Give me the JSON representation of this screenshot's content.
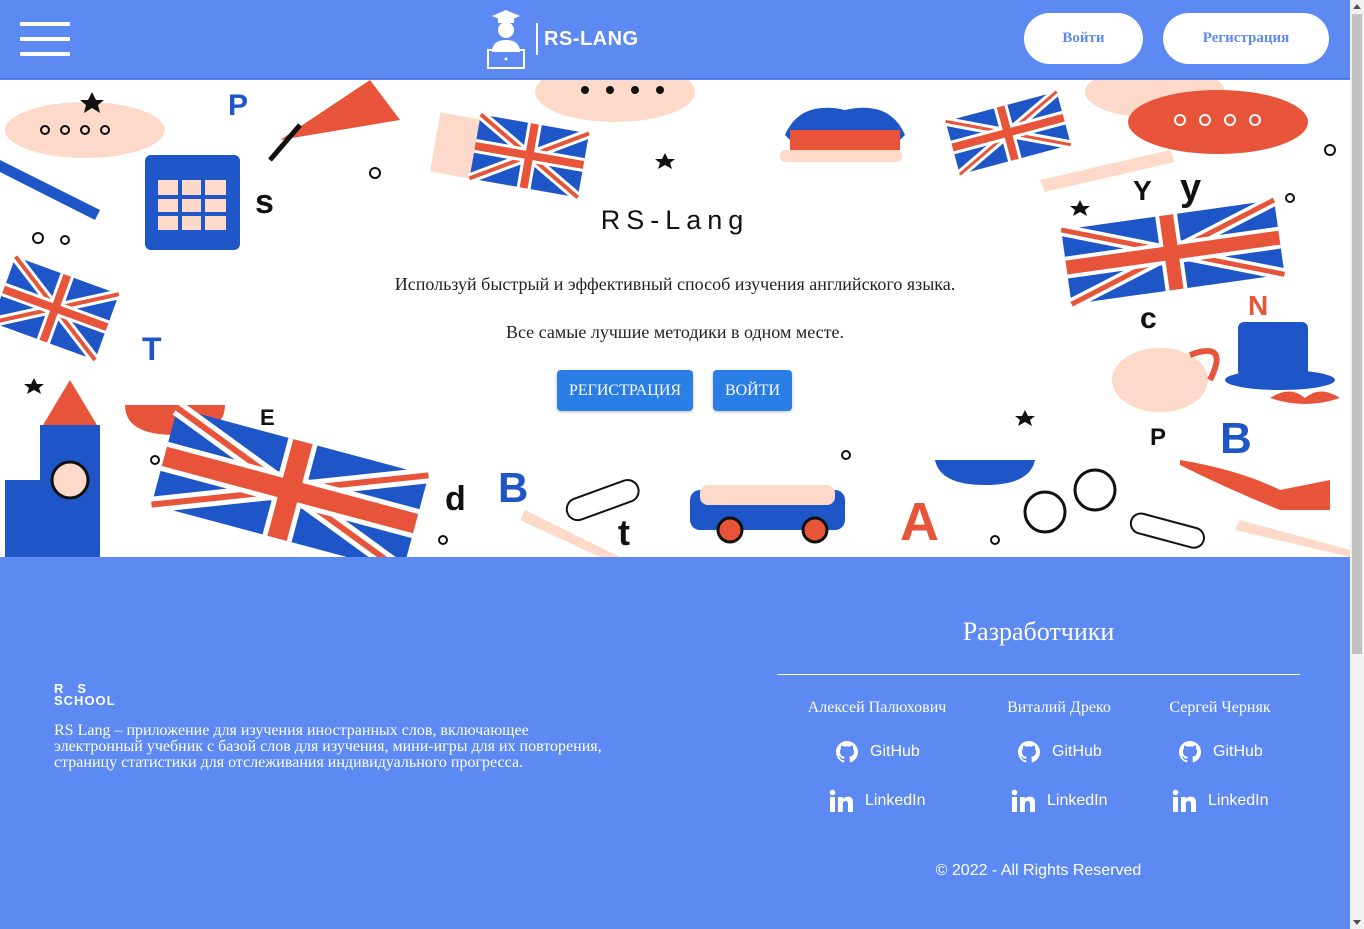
{
  "header": {
    "logo_text": "RS-LANG",
    "login_label": "Войти",
    "register_label": "Регистрация"
  },
  "hero": {
    "title": "RS-Lang",
    "line1": "Используй быстрый и эффективный способ изучения английского языка.",
    "line2": "Все самые лучшие методики в одном месте.",
    "register_cta": "РЕГИСТРАЦИЯ",
    "login_cta": "ВОЙТИ"
  },
  "footer": {
    "rss_line1": "RS",
    "rss_line2": "SCHOOL",
    "about": "RS Lang – приложение для изучения иностранных слов, включающее электронный учебник с базой слов для изучения, мини-игры для их повторения, страницу статистики для отслеживания индивидуального прогресса.",
    "developers_title": "Разработчики",
    "developers": [
      {
        "name": "Алексей Палюхович",
        "github": "GitHub",
        "linkedin": "LinkedIn"
      },
      {
        "name": "Виталий Дреко",
        "github": "GitHub",
        "linkedin": "LinkedIn"
      },
      {
        "name": "Сергей Черняк",
        "github": "GitHub",
        "linkedin": "LinkedIn"
      }
    ],
    "copyright": "© 2022 - All Rights Reserved"
  },
  "colors": {
    "primary": "#5d89f2",
    "cta": "#2a7ee5",
    "flag_red": "#e8543a",
    "flag_blue": "#1e56c8",
    "peach": "#fcd9c8"
  },
  "icons": [
    "menu-icon",
    "student-logo-icon",
    "github-icon",
    "linkedin-icon"
  ]
}
